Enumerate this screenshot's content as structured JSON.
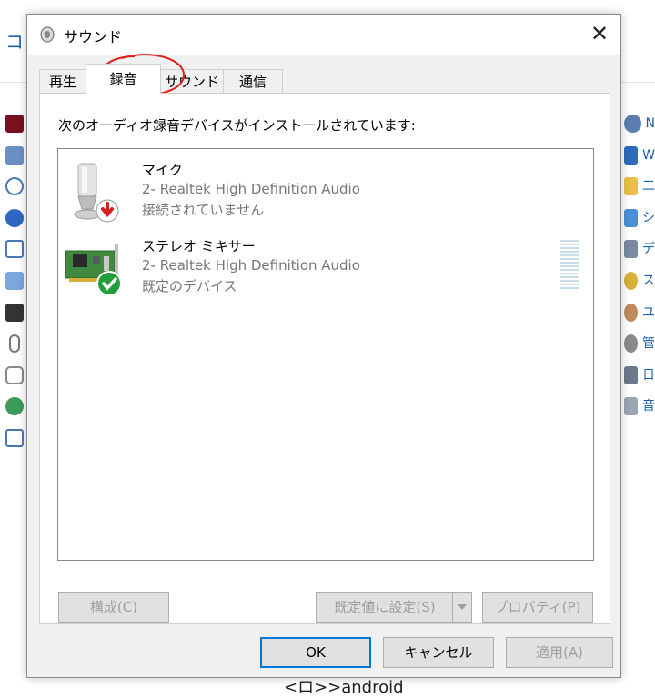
{
  "background": {
    "title_fragment": "コン",
    "bottom_text_fragment": "<ロ>>android",
    "right_item_initials": [
      "N",
      "W",
      "二",
      "シ",
      "デ",
      "ス",
      "ユ",
      "管",
      "日",
      "音"
    ]
  },
  "dialog": {
    "title": "サウンド",
    "close_glyph": "✕",
    "tabs": [
      {
        "label": "再生"
      },
      {
        "label": "録音"
      },
      {
        "label": "サウンド"
      },
      {
        "label": "通信"
      }
    ],
    "active_tab": "録音",
    "instruction": "次のオーディオ録音デバイスがインストールされています:",
    "devices": [
      {
        "name": "マイク",
        "description": "2- Realtek High Definition Audio",
        "status": "接続されていません",
        "icon": "microphone-icon",
        "badge": "disconnected-arrow-icon"
      },
      {
        "name": "ステレオ ミキサー",
        "description": "2- Realtek High Definition Audio",
        "status": "既定のデバイス",
        "icon": "sound-card-icon",
        "badge": "default-check-icon"
      }
    ],
    "buttons": {
      "configure": "構成(C)",
      "set_default": "既定値に設定(S)",
      "properties": "プロパティ(P)",
      "ok": "OK",
      "cancel": "キャンセル",
      "apply": "適用(A)"
    },
    "colors": {
      "accent": "#0078d7",
      "annotation": "#e0201b",
      "check": "#1f9e3a",
      "disconnected": "#d42020",
      "level_meter": "#c9dde8"
    }
  }
}
